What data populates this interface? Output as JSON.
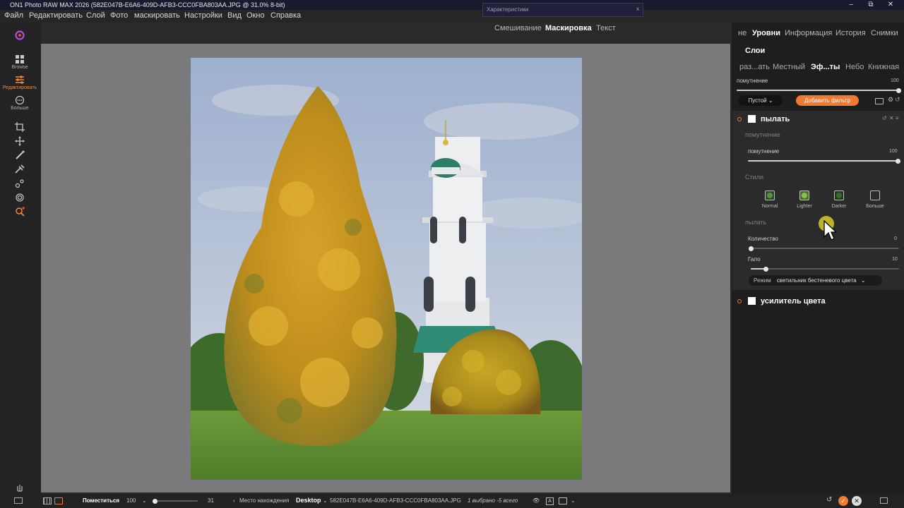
{
  "window": {
    "title": "ON1 Photo RAW MAX 2026 (582E047B-E6A6-409D-AFB3-CCC0FBA803AA.JPG @ 31.0% 8-bit)"
  },
  "menu": [
    "Файл",
    "Редактировать",
    "Слой",
    "Фото",
    "маскировать",
    "Настройки",
    "Вид",
    "Окно",
    "Справка"
  ],
  "floating_panel": {
    "title": "Характеристики",
    "close": "x"
  },
  "mode_tabs": {
    "blend": "Смешивание",
    "mask": "Маскировка",
    "text": "Текст"
  },
  "left_tools": {
    "browse": "Browse",
    "edit": "Редактировать",
    "more": "Больше"
  },
  "right_tabs": {
    "t0": "не",
    "levels": "Уровни",
    "info": "Информация",
    "history": "История",
    "snapshots": "Снимки"
  },
  "layers_title": "Слои",
  "sub_tabs": {
    "develop": "раз...ать",
    "local": "Местный",
    "effects": "Эф...ты",
    "sky": "Небо",
    "book": "Книжная"
  },
  "global_opacity": {
    "label": "помутнение",
    "value": "100",
    "level": 1.0
  },
  "preset_select": "Пустой",
  "add_filter": "Добавить фильтр",
  "filter": {
    "name": "пылать",
    "opacity_section": "помутнение",
    "opacity_label": "помутнение",
    "opacity_value": "100",
    "opacity_level": 1.0,
    "styles_section": "Стили",
    "styles": [
      "Normal",
      "Lighter",
      "Darker",
      "Больше"
    ],
    "glow_section": "пылать",
    "amount_label": "Количество",
    "amount_value": "0",
    "amount_level": 0.0,
    "halo_label": "Гало",
    "halo_value": "10",
    "halo_level": 0.1,
    "mode_label": "Режим",
    "mode_value": "светильник бестеневого цвета"
  },
  "filter2": {
    "name": "усилитель цвета"
  },
  "bottom": {
    "fit": "Поместиться",
    "zoom": "100",
    "slider_value": "31",
    "location_label": "Место нахождения",
    "location": "Desktop",
    "filename": "582E047B-E6A6-409D-AFB3-CCC0FBA803AA.JPG",
    "selection": "1 выбрано -5 всего"
  },
  "colors": {
    "accent": "#f07a30",
    "canvas": "#7a797c",
    "panel": "#1e1e1e"
  }
}
